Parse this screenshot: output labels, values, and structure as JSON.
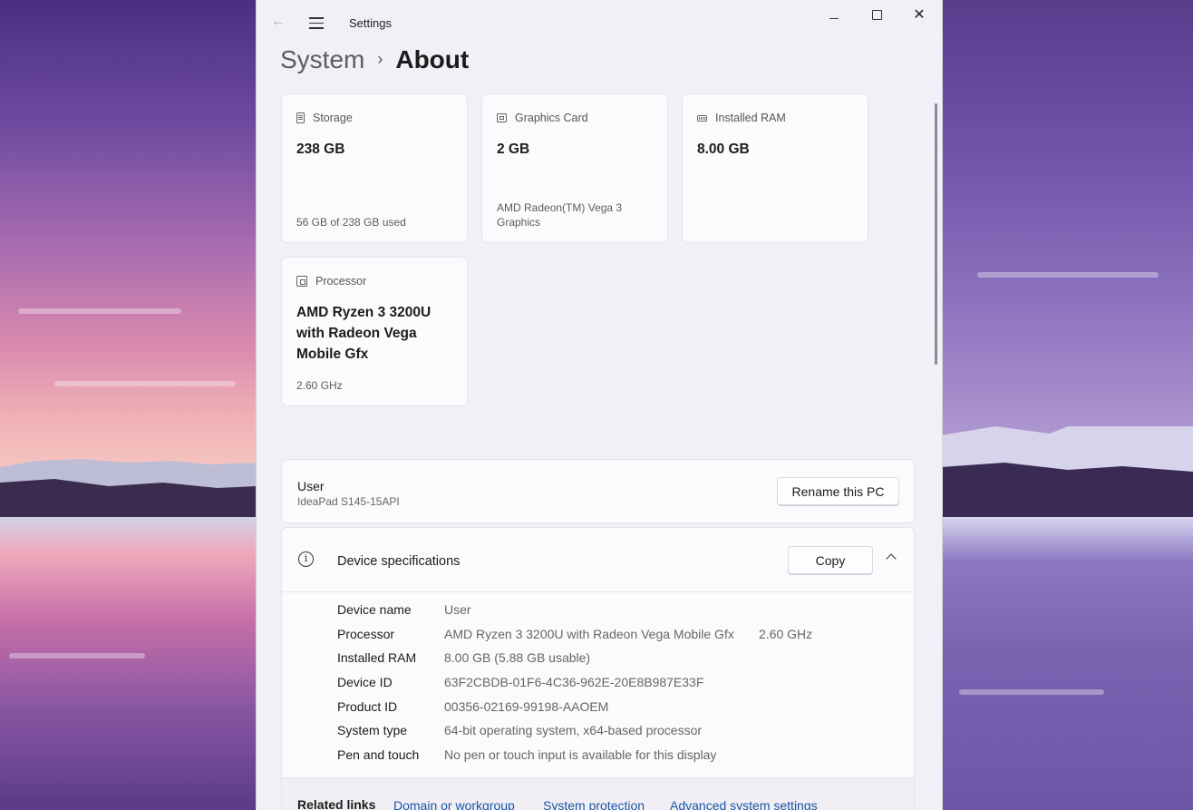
{
  "window": {
    "title": "Settings"
  },
  "breadcrumb": {
    "parent": "System",
    "separator": "›",
    "current": "About"
  },
  "cards": {
    "storage": {
      "label": "Storage",
      "value": "238 GB",
      "sub": "56 GB of 238 GB used",
      "icon": "storage-icon"
    },
    "graphics": {
      "label": "Graphics Card",
      "value": "2 GB",
      "sub": "AMD Radeon(TM) Vega 3 Graphics",
      "icon": "graphics-card-icon"
    },
    "ram": {
      "label": "Installed RAM",
      "value": "8.00 GB",
      "icon": "ram-icon"
    },
    "processor": {
      "label": "Processor",
      "value": "AMD Ryzen 3 3200U with Radeon Vega Mobile Gfx",
      "sub": "2.60 GHz",
      "icon": "processor-icon"
    }
  },
  "user_panel": {
    "name": "User",
    "model": "IdeaPad S145-15API",
    "rename_label": "Rename this PC"
  },
  "specs": {
    "title": "Device specifications",
    "copy_label": "Copy",
    "rows": [
      {
        "label": "Device name",
        "value": "User"
      },
      {
        "label": "Processor",
        "value": "AMD Ryzen 3 3200U with Radeon Vega Mobile Gfx",
        "extra": "2.60 GHz"
      },
      {
        "label": "Installed RAM",
        "value": "8.00 GB (5.88 GB usable)"
      },
      {
        "label": "Device ID",
        "value": "63F2CBDB-01F6-4C36-962E-20E8B987E33F"
      },
      {
        "label": "Product ID",
        "value": "00356-02169-99198-AAOEM"
      },
      {
        "label": "System type",
        "value": "64-bit operating system, x64-based processor"
      },
      {
        "label": "Pen and touch",
        "value": "No pen or touch input is available for this display"
      }
    ]
  },
  "related": {
    "label": "Related links",
    "links": [
      "Domain or workgroup",
      "System protection",
      "Advanced system settings"
    ]
  },
  "colors": {
    "accent_link": "#1a55a8",
    "window_bg": "#f2eff6",
    "card_bg": "#fbfafd"
  }
}
